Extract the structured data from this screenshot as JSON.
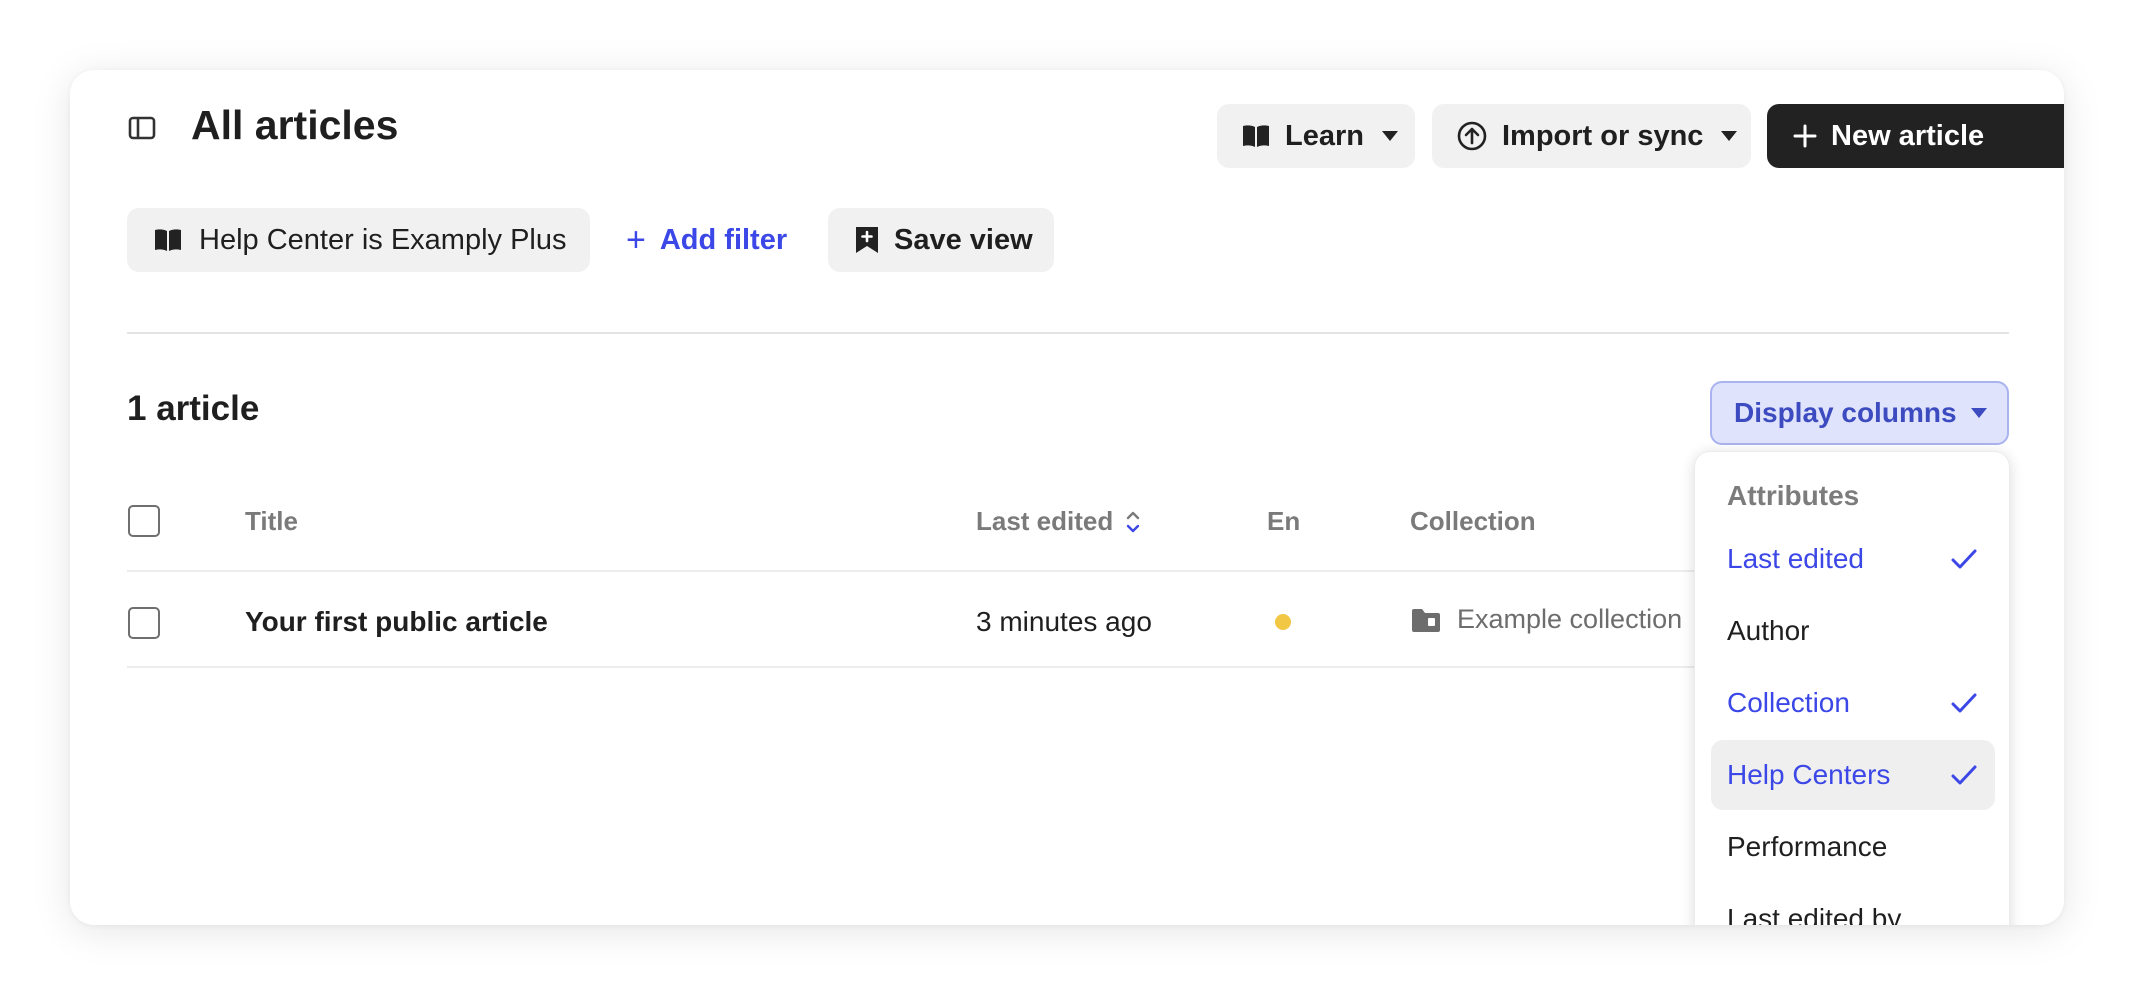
{
  "header": {
    "title": "All articles",
    "learn_label": "Learn",
    "import_label": "Import or sync",
    "new_article_label": "New article"
  },
  "filters": {
    "chip_key": "Help Center",
    "chip_op": "is",
    "chip_value": "Examply Plus",
    "add_filter_label": "Add filter",
    "save_view_label": "Save view"
  },
  "list": {
    "count_label": "1 article",
    "display_columns_label": "Display columns",
    "columns": {
      "title": "Title",
      "last_edited": "Last edited",
      "language": "En",
      "collection": "Collection"
    },
    "rows": [
      {
        "title": "Your first public article",
        "last_edited": "3 minutes ago",
        "status_color": "#f2c744",
        "collection": "Example collection"
      }
    ]
  },
  "dropdown": {
    "header": "Attributes",
    "items": [
      {
        "label": "Last edited",
        "checked": true
      },
      {
        "label": "Author",
        "checked": false
      },
      {
        "label": "Collection",
        "checked": true
      },
      {
        "label": "Help Centers",
        "checked": true
      },
      {
        "label": "Performance",
        "checked": false
      },
      {
        "label": "Last edited by",
        "checked": false
      }
    ]
  },
  "colors": {
    "accent": "#3b47e6",
    "primary_button": "#222222",
    "status_dot": "#f2c744"
  },
  "icons": {
    "sidebar_toggle": "sidebar-toggle-icon",
    "learn": "book-icon",
    "import": "upload-circle-icon",
    "new_article": "plus-icon",
    "help_center": "book-icon",
    "save_view": "bookmark-plus-icon",
    "sort": "sort-icon",
    "collection": "folder-icon",
    "checked": "check-icon"
  }
}
